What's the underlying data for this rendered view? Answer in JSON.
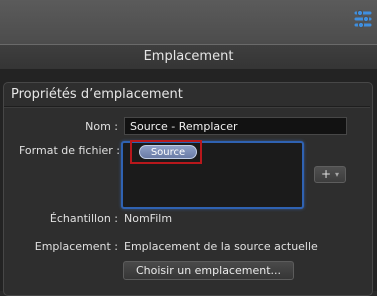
{
  "header": {
    "title": "Emplacement"
  },
  "panel": {
    "title": "Propriétés d’emplacement",
    "name_label": "Nom :",
    "name_value": "Source - Remplacer",
    "format_label": "Format de fichier :",
    "format_token": "Source",
    "add_button_plus": "+",
    "add_button_caret": "▾",
    "sample_label": "Échantillon :",
    "sample_value": "NomFilm",
    "location_label": "Emplacement :",
    "location_value": "Emplacement de la source actuelle",
    "choose_button": "Choisir un emplacement..."
  },
  "colors": {
    "accent_blue": "#2f62b2",
    "highlight_red": "#b8181c",
    "token_fill": "#7c8cb6",
    "settings_icon": "#3f8fe0"
  },
  "icons": {
    "settings": "sliders-settings-icon"
  }
}
